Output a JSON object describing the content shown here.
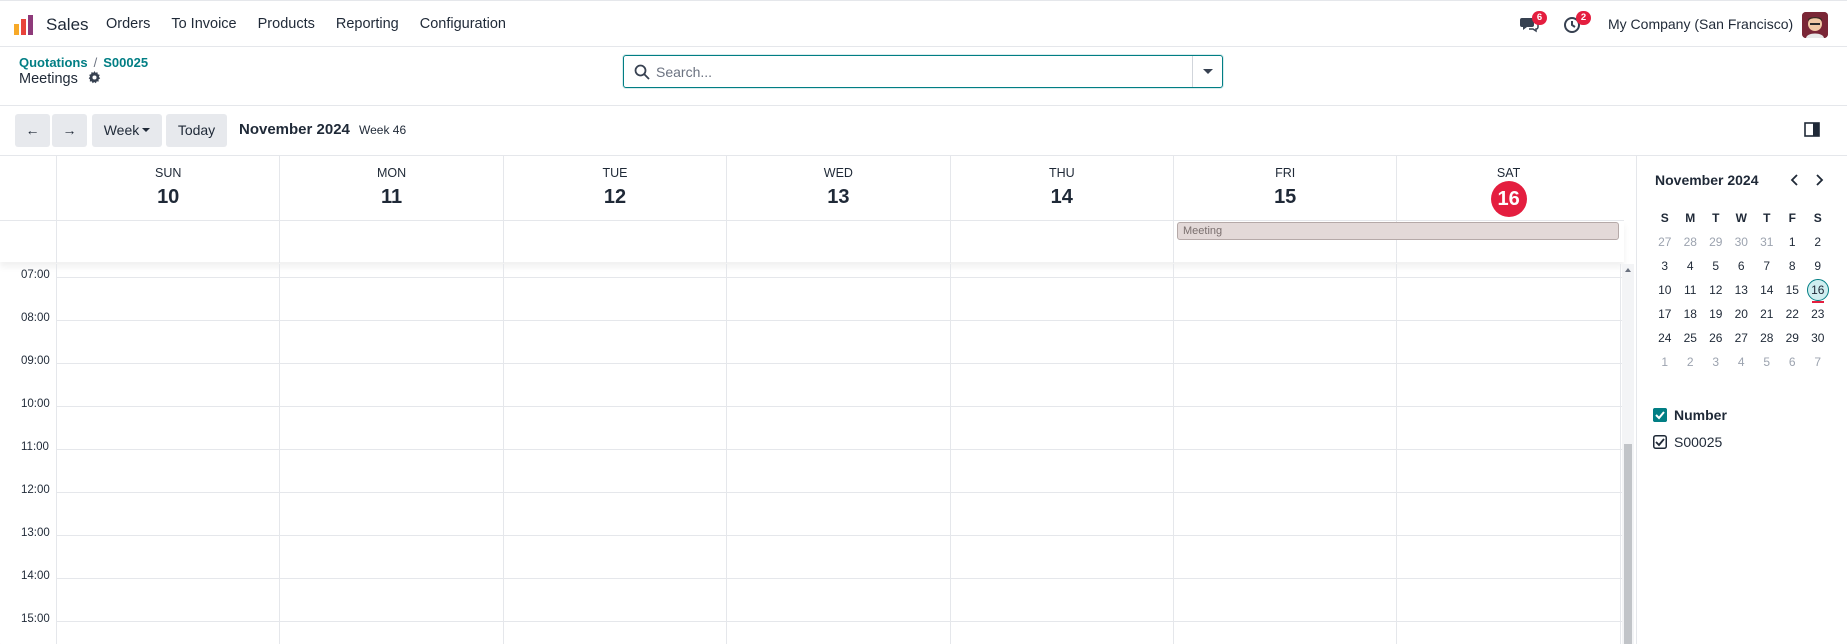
{
  "navbar": {
    "app_name": "Sales",
    "menu": [
      "Orders",
      "To Invoice",
      "Products",
      "Reporting",
      "Configuration"
    ],
    "messages_badge": "6",
    "activities_badge": "2",
    "company": "My Company (San Francisco)"
  },
  "breadcrumb": {
    "parent": "Quotations",
    "record": "S00025",
    "separator": "/"
  },
  "page_title": "Meetings",
  "search": {
    "placeholder": "Search..."
  },
  "toolbar": {
    "prev_label": "←",
    "next_label": "→",
    "scale_label": "Week",
    "today_label": "Today",
    "range_title": "November 2024",
    "range_week": "Week 46"
  },
  "week": {
    "days": [
      {
        "name": "SUN",
        "num": "10"
      },
      {
        "name": "MON",
        "num": "11"
      },
      {
        "name": "TUE",
        "num": "12"
      },
      {
        "name": "WED",
        "num": "13"
      },
      {
        "name": "THU",
        "num": "14"
      },
      {
        "name": "FRI",
        "num": "15"
      },
      {
        "name": "SAT",
        "num": "16",
        "today": true
      }
    ],
    "hours": [
      "07:00",
      "08:00",
      "09:00",
      "10:00",
      "11:00",
      "12:00",
      "13:00",
      "14:00",
      "15:00"
    ],
    "allday_event": {
      "label": "Meeting",
      "start_day": "FRI",
      "end_day": "SAT"
    }
  },
  "mini_calendar": {
    "title": "November 2024",
    "weekdays": [
      "S",
      "M",
      "T",
      "W",
      "T",
      "F",
      "S"
    ],
    "weeks": [
      [
        "27",
        "28",
        "29",
        "30",
        "31",
        "1",
        "2"
      ],
      [
        "3",
        "4",
        "5",
        "6",
        "7",
        "8",
        "9"
      ],
      [
        "10",
        "11",
        "12",
        "13",
        "14",
        "15",
        "16"
      ],
      [
        "17",
        "18",
        "19",
        "20",
        "21",
        "22",
        "23"
      ],
      [
        "24",
        "25",
        "26",
        "27",
        "28",
        "29",
        "30"
      ],
      [
        "1",
        "2",
        "3",
        "4",
        "5",
        "6",
        "7"
      ]
    ],
    "selected": "16"
  },
  "filters": {
    "group_label": "Number",
    "items": [
      "S00025"
    ]
  },
  "colors": {
    "accent": "#017e84",
    "today": "#e41e3f",
    "event_bg": "#e3d9d8"
  }
}
